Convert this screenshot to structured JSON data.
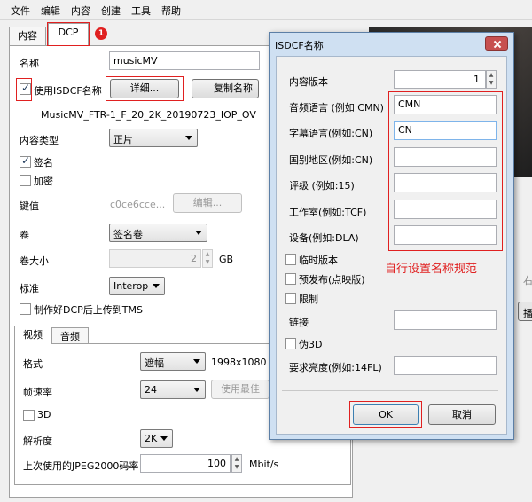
{
  "menu": [
    "文件",
    "编辑",
    "内容",
    "创建",
    "工具",
    "帮助"
  ],
  "tabs": {
    "content": "内容",
    "dcp": "DCP"
  },
  "badges": {
    "one": "1",
    "two": "2"
  },
  "name_label": "名称",
  "name_value": "musicMV",
  "use_isdcf_label": "使用ISDCF名称",
  "details_button": "详细...",
  "copy_name_button": "复制名称",
  "dcp_full_name": "MusicMV_FTR-1_F_20_2K_20190723_IOP_OV",
  "content_type_label": "内容类型",
  "content_type_value": "正片",
  "sign_label": "签名",
  "encrypt_label": "加密",
  "key_label": "键值",
  "key_value": "c0ce6cce...",
  "edit_button": "编辑...",
  "volume_label": "卷",
  "volume_value": "签名卷",
  "volume_size_label": "卷大小",
  "volume_size_value": "2",
  "volume_size_unit": "GB",
  "standard_label": "标准",
  "standard_value": "Interop",
  "upload_tms_label": "制作好DCP后上传到TMS",
  "subtabs": {
    "video": "视频",
    "audio": "音频"
  },
  "format_label": "格式",
  "format_value": "遮幅",
  "format_res": "1998x1080",
  "framerate_label": "帧速率",
  "framerate_value": "24",
  "best_button": "使用最佳",
  "three_d_label": "3D",
  "resolution_label": "解析度",
  "resolution_value": "2K",
  "bitrate_label": "上次使用的JPEG2000码率",
  "bitrate_value": "100",
  "bitrate_unit": "Mbit/s",
  "dialog": {
    "title": "ISDCF名称",
    "content_version_label": "内容版本",
    "content_version_value": "1",
    "audio_lang_label": "音频语言 (例如 CMN)",
    "audio_lang_value": "CMN",
    "subtitle_lang_label": "字幕语言(例如:CN)",
    "subtitle_lang_value": "CN",
    "territory_label": "国别地区(例如:CN)",
    "territory_value": "",
    "rating_label": "评级 (例如:15)",
    "rating_value": "",
    "studio_label": "工作室(例如:TCF)",
    "studio_value": "",
    "facility_label": "设备(例如:DLA)",
    "facility_value": "",
    "temp_version_label": "临时版本",
    "pre_release_label": "预发布(点映版)",
    "restricted_label": "限制",
    "chain_label": "链接",
    "chain_value": "",
    "two_d_version_label": "伪3D",
    "luminance_label": "要求亮度(例如:14FL)",
    "luminance_value": "",
    "ok_button": "OK",
    "cancel_button": "取消"
  },
  "annotation": "自行设置名称规范",
  "right_fragments": {
    "radio_text": "右",
    "btn_text": "播"
  },
  "colors": {
    "annotation": "#e02020",
    "badge": "#e02020",
    "dialog_frame": "#cfe0f2"
  }
}
